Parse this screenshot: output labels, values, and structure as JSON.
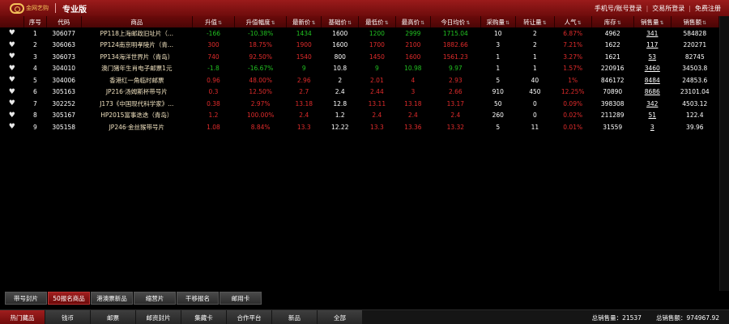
{
  "header": {
    "logo_text": "金网艺购",
    "edition": "专业版",
    "auth": [
      "手机号/账号登录",
      "交易所登录",
      "免费注册"
    ]
  },
  "columns": [
    "",
    "序号",
    "代码",
    "商品",
    "升值",
    "升值幅度",
    "最新价",
    "基础价",
    "最低价",
    "最高价",
    "今日均价",
    "采购量",
    "转让量",
    "人气",
    "库存",
    "销售量",
    "销售额"
  ],
  "rows": [
    [
      "1",
      "306077",
      "PP118上海邮政旧址片（...",
      "-166",
      "-10.38%",
      "1434",
      "1600",
      "1200",
      "2999",
      "1715.04",
      "10",
      "2",
      "6.87%",
      "4962",
      "341",
      "584828"
    ],
    [
      "2",
      "306063",
      "PP124南京明孝陵片（青...",
      "300",
      "18.75%",
      "1900",
      "1600",
      "1700",
      "2100",
      "1882.66",
      "3",
      "2",
      "7.21%",
      "1622",
      "117",
      "220271"
    ],
    [
      "3",
      "306073",
      "PP134海洋世界片（青岛）",
      "740",
      "92.50%",
      "1540",
      "800",
      "1450",
      "1600",
      "1561.23",
      "1",
      "1",
      "3.27%",
      "1621",
      "53",
      "82745"
    ],
    [
      "4",
      "304010",
      "澳门猪年生肖电子邮票1元",
      "-1.8",
      "-16.67%",
      "9",
      "10.8",
      "9",
      "10.98",
      "9.97",
      "1",
      "1",
      "1.57%",
      "220916",
      "3460",
      "34503.8"
    ],
    [
      "5",
      "304006",
      "香港红一角临时邮票",
      "0.96",
      "48.00%",
      "2.96",
      "2",
      "2.01",
      "4",
      "2.93",
      "5",
      "40",
      "1%",
      "846172",
      "8484",
      "24853.6"
    ],
    [
      "6",
      "305163",
      "JP216·汤姆斯杯带号片",
      "0.3",
      "12.50%",
      "2.7",
      "2.4",
      "2.44",
      "3",
      "2.66",
      "910",
      "450",
      "12.25%",
      "70890",
      "8686",
      "23101.04"
    ],
    [
      "7",
      "302252",
      "J173《中国现代科学家》...",
      "0.38",
      "2.97%",
      "13.18",
      "12.8",
      "13.11",
      "13.18",
      "13.17",
      "50",
      "0",
      "0.09%",
      "398308",
      "342",
      "4503.12"
    ],
    [
      "8",
      "305167",
      "HP2015富事迭迭（青岛）",
      "1.2",
      "100.00%",
      "2.4",
      "1.2",
      "2.4",
      "2.4",
      "2.4",
      "260",
      "0",
      "0.02%",
      "211289",
      "51",
      "122.4"
    ],
    [
      "9",
      "305158",
      "JP246·金丝猴带号片",
      "1.08",
      "8.84%",
      "13.3",
      "12.22",
      "13.3",
      "13.36",
      "13.32",
      "5",
      "11",
      "0.01%",
      "31559",
      "3",
      "39.96"
    ]
  ],
  "subtabs": [
    "带号封片",
    "50报名商品",
    "港澳票新品",
    "缩营片",
    "干移报名",
    "邮用卡"
  ],
  "active_subtab": 1,
  "maintabs": [
    "热门藏品",
    "钱币",
    "邮票",
    "邮资封片",
    "集藏卡",
    "合作平台",
    "新品",
    "全部"
  ],
  "active_maintab": 0,
  "totals": {
    "volume_label": "总销售量：",
    "volume": "21537",
    "amount_label": "总销售额：",
    "amount": "974967.92"
  },
  "colors": {
    "header_red": "#9b1b1b",
    "rise_red": "#e02b2b",
    "fall_green": "#21c121",
    "name_color": "#f2e3c1",
    "hot_yellow": "#e8e060",
    "background": "#000000"
  }
}
